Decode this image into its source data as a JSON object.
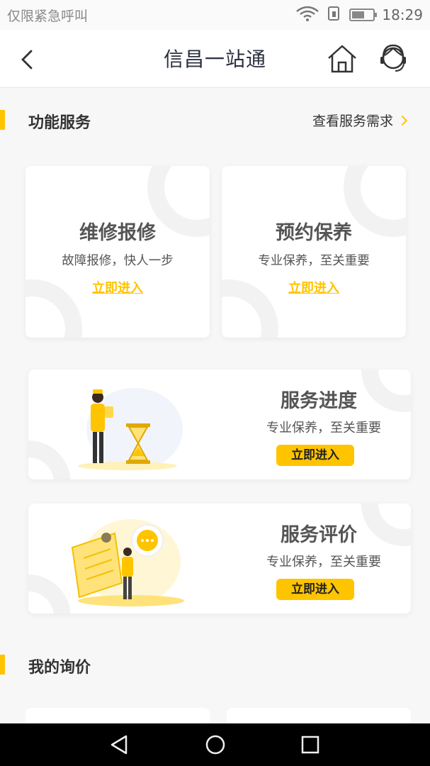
{
  "status_bar": {
    "left_text": "仅限紧急呼叫",
    "time": "18:29",
    "battery_level": 0.6
  },
  "header": {
    "title": "信昌一站通",
    "back_icon": "chevron-left-icon",
    "home_icon": "home-icon",
    "service_icon": "customer-service-icon"
  },
  "function_section": {
    "title": "功能服务",
    "link_label": "查看服务需求"
  },
  "service_cards": [
    {
      "title": "维修报修",
      "subtitle": "故障报修，快人一步",
      "action": "立即进入"
    },
    {
      "title": "预约保养",
      "subtitle": "专业保养，至关重要",
      "action": "立即进入"
    }
  ],
  "wide_cards": [
    {
      "title": "服务进度",
      "subtitle": "专业保养，至关重要",
      "action": "立即进入"
    },
    {
      "title": "服务评价",
      "subtitle": "专业保养，至关重要",
      "action": "立即进入"
    }
  ],
  "inquiry_section": {
    "title": "我的询价"
  },
  "colors": {
    "accent": "#ffc400",
    "title_text": "#2b3040",
    "body_text": "#555555"
  }
}
